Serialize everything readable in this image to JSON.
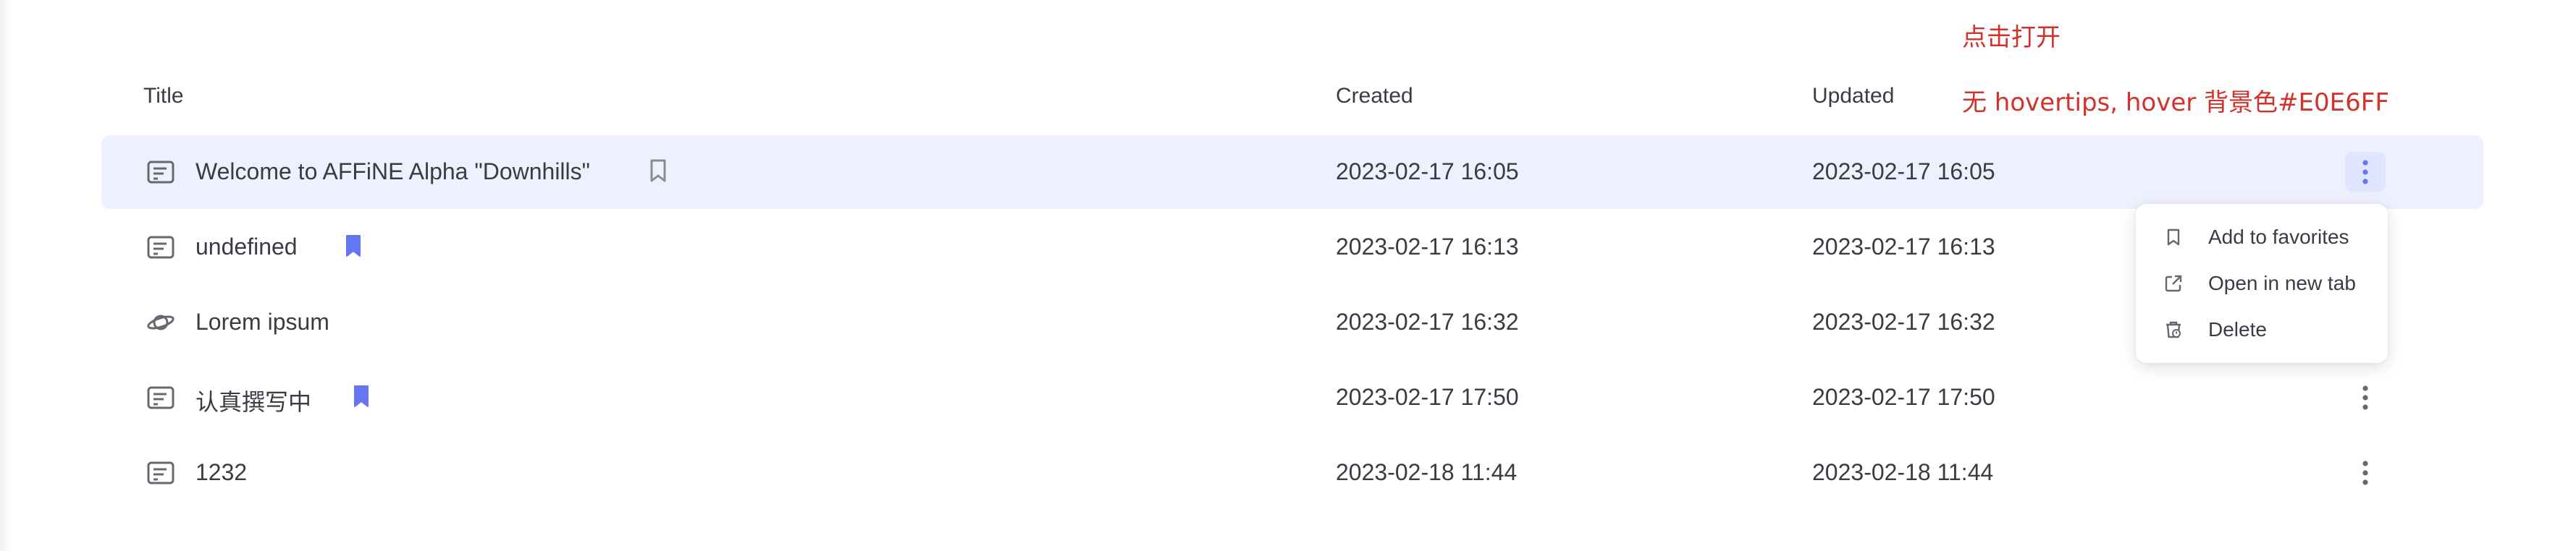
{
  "header": {
    "title": "Title",
    "created": "Created",
    "updated": "Updated"
  },
  "annotations": {
    "open_note": "点击打开",
    "hover_note": "无 hovertips, hover 背景色#E0E6FF"
  },
  "colors": {
    "annotation": "#d4312a",
    "hover_row_bg": "#eef1fd",
    "more_button_hover_bg": "#E0E6FF",
    "favorite_accent": "#6477f0",
    "text": "#3a3c44",
    "icon": "#66686f"
  },
  "rows": [
    {
      "icon": "doc-icon",
      "title": "Welcome to AFFiNE Alpha \"Downhills\"",
      "favorite": false,
      "created": "2023-02-17 16:05",
      "updated": "2023-02-17 16:05",
      "hovered": true,
      "more_visible": true
    },
    {
      "icon": "doc-icon",
      "title": "undefined",
      "favorite": true,
      "created": "2023-02-17 16:13",
      "updated": "2023-02-17 16:13",
      "hovered": false,
      "more_visible": false
    },
    {
      "icon": "planet-icon",
      "title": "Lorem ipsum",
      "favorite": false,
      "created": "2023-02-17 16:32",
      "updated": "2023-02-17 16:32",
      "hovered": false,
      "more_visible": false
    },
    {
      "icon": "doc-icon",
      "title": "认真撰写中",
      "favorite": true,
      "created": "2023-02-17 17:50",
      "updated": "2023-02-17 17:50",
      "hovered": false,
      "more_visible": true
    },
    {
      "icon": "doc-icon",
      "title": "1232",
      "favorite": false,
      "created": "2023-02-18 11:44",
      "updated": "2023-02-18 11:44",
      "hovered": false,
      "more_visible": true
    }
  ],
  "context_menu": {
    "items": [
      {
        "label": "Add to favorites",
        "icon": "bookmark-icon"
      },
      {
        "label": "Open in new tab",
        "icon": "open-in-new-tab-icon"
      },
      {
        "label": "Delete",
        "icon": "trash-icon"
      }
    ]
  }
}
